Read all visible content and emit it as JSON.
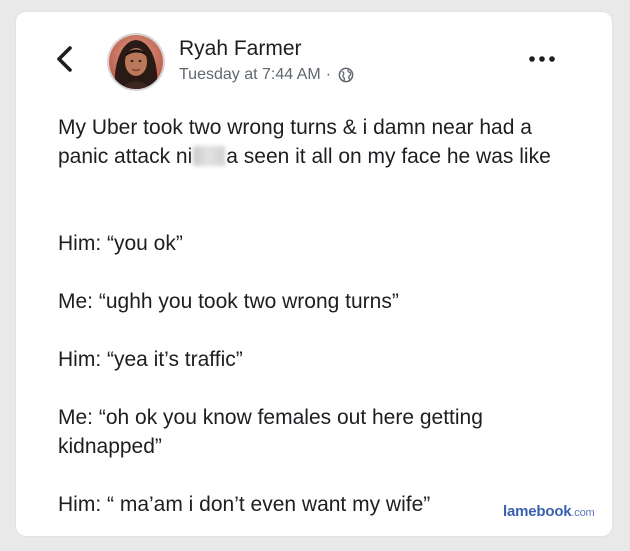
{
  "post": {
    "author": "Ryah Farmer",
    "timestamp": "Tuesday at 7:44 AM",
    "separator": "·",
    "privacy_icon": "globe-icon",
    "paragraphs": {
      "p1_before": "My Uber took two wrong turns & i damn near had a panic attack ni",
      "p1_after": "a seen it all on my face he was like",
      "p2": "Him: “you ok”",
      "p3": "Me: “ughh you took two wrong turns”",
      "p4": "Him: “yea it’s traffic”",
      "p5": "Me: “oh ok you know females out here getting kidnapped”",
      "p6": "Him: “ ma’am i don’t even want my wife”"
    }
  },
  "header": {
    "back_icon": "chevron-left-icon",
    "more_icon": "more-options-icon"
  },
  "watermark": {
    "brand": "lamebook",
    "domain": ".com"
  },
  "colors": {
    "background": "#e9e9e9",
    "card": "#ffffff",
    "text": "#1c1e21",
    "meta": "#606770",
    "watermark": "#3a5fb0"
  }
}
